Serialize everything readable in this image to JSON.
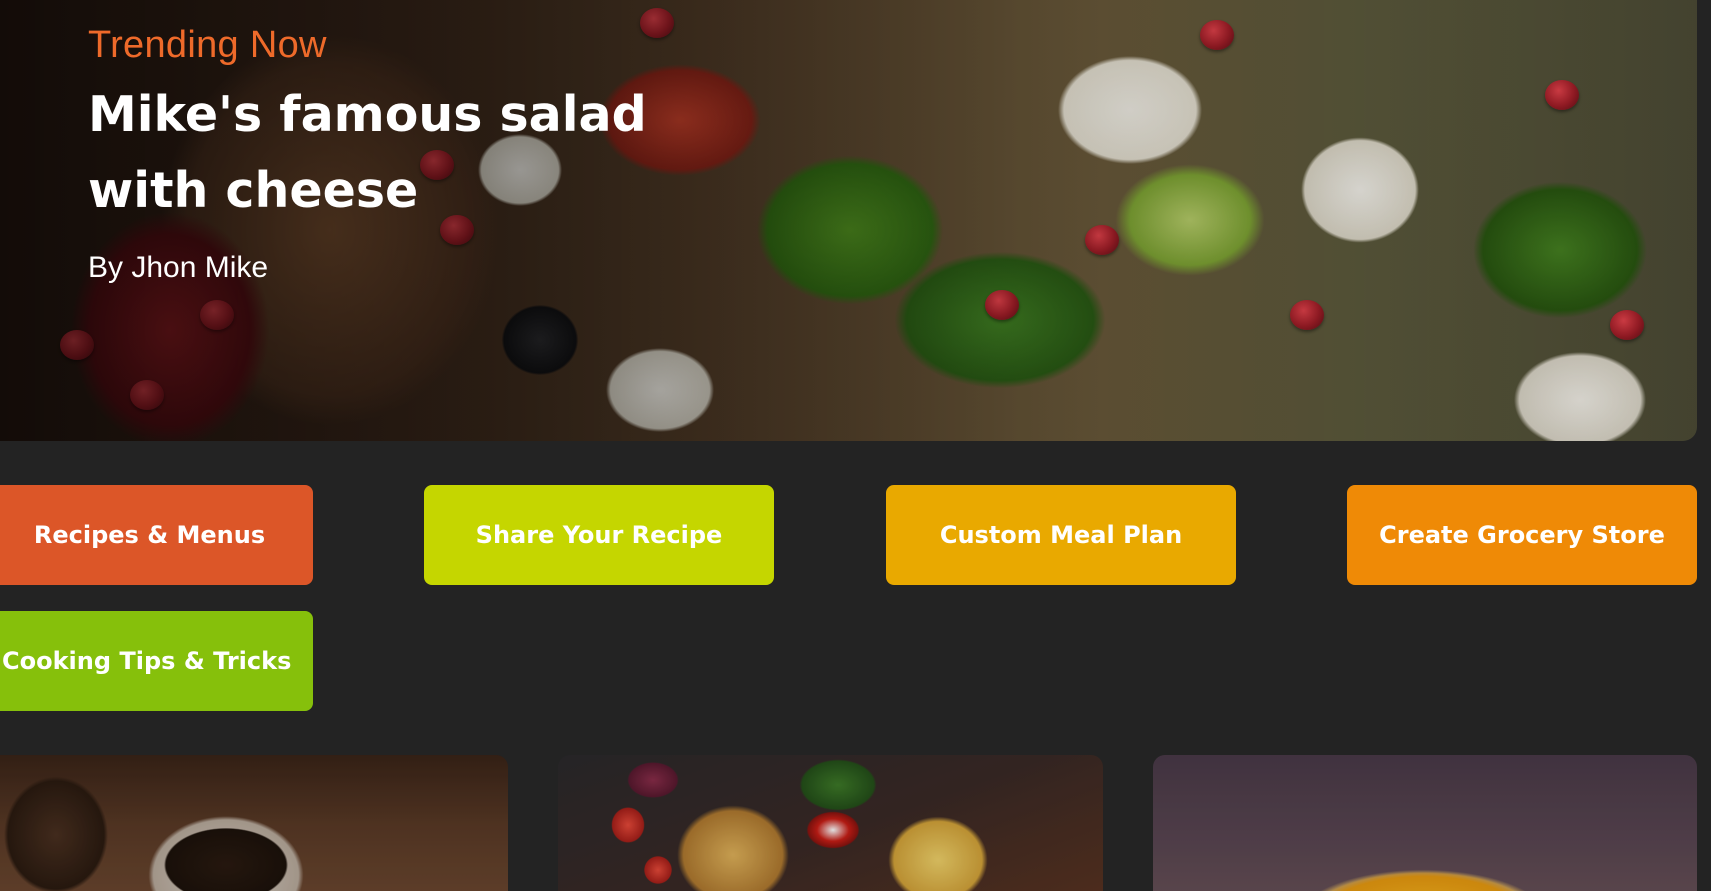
{
  "hero": {
    "eyebrow": "Trending Now",
    "title": "Mike's famous salad with cheese",
    "author": "By Jhon Mike",
    "image": "salad-photo"
  },
  "categories": [
    {
      "label": "Recipes & Menus",
      "color": "#dc5628"
    },
    {
      "label": "Share Your Recipe",
      "color": "#c5d600"
    },
    {
      "label": "Custom Meal Plan",
      "color": "#e9a900"
    },
    {
      "label": "Create Grocery Store",
      "color": "#ef8a06"
    },
    {
      "label": "Cooking Tips & Tricks",
      "color": "#86c00b"
    }
  ],
  "cards": [
    {
      "image": "coffee-cup-photo"
    },
    {
      "image": "sandwich-and-fries-photo"
    },
    {
      "image": "omelette-photo"
    }
  ],
  "colors": {
    "background": "#232323",
    "accent": "#ee6a2a"
  }
}
